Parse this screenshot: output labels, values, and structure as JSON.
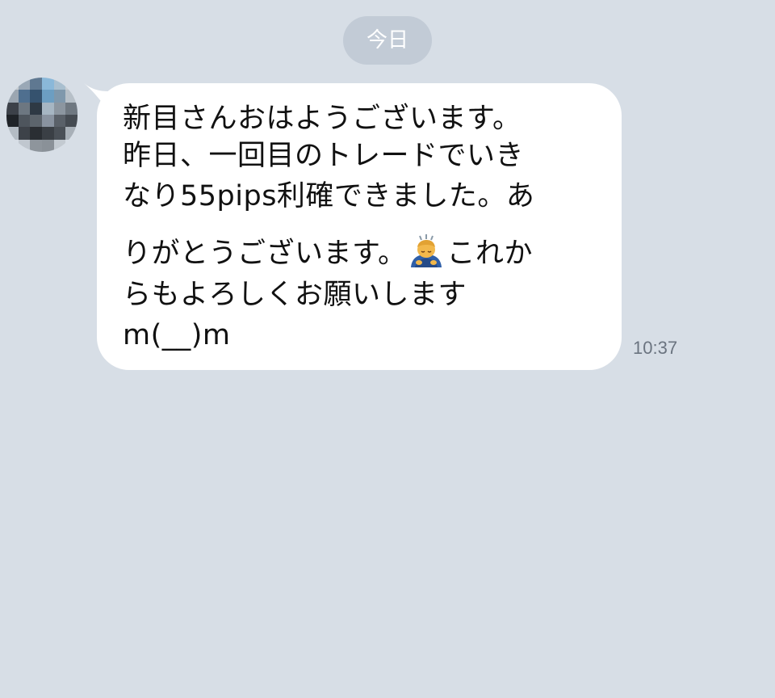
{
  "chat": {
    "date_label": "今日",
    "message": {
      "lines": [
        "新目さんおはようございます。",
        "昨日、一回目のトレードでいき",
        "なり55pips利確できました。あ",
        "りがとうございます。",
        "これか",
        "らもよろしくお願いします",
        "m(__)m"
      ],
      "emoji": "person-bowing-emoji",
      "time": "10:37"
    },
    "avatar_icon": "pixelated-avatar-icon",
    "colors": {
      "background": "#d7dee6",
      "date_pill": "#c2cbd6",
      "bubble": "#ffffff",
      "timestamp": "#6b7480"
    }
  }
}
